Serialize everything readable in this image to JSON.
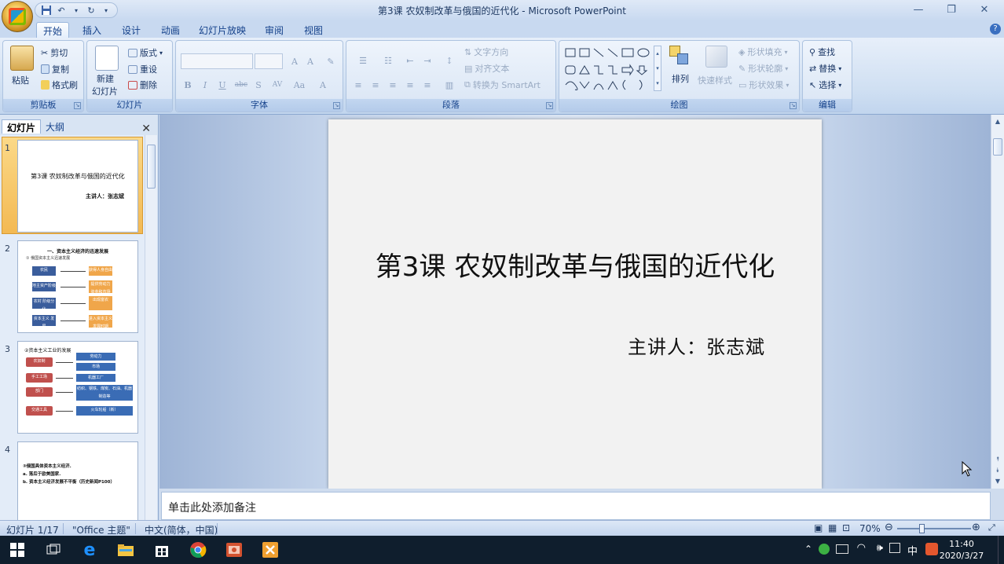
{
  "window": {
    "title": "第3课 农奴制改革与俄国的近代化 - Microsoft PowerPoint"
  },
  "quick_access": {
    "save_icon": "save-icon",
    "undo_icon": "undo-icon",
    "redo_icon": "redo-icon"
  },
  "ribbon_tabs": [
    "开始",
    "插入",
    "设计",
    "动画",
    "幻灯片放映",
    "审阅",
    "视图"
  ],
  "ribbon": {
    "clipboard": {
      "paste": "粘贴",
      "cut": "剪切",
      "copy": "复制",
      "format_painter": "格式刷",
      "label": "剪贴板"
    },
    "slides": {
      "new_slide": "新建",
      "new_slide_2": "幻灯片",
      "layout": "版式",
      "reset": "重设",
      "delete": "删除",
      "label": "幻灯片"
    },
    "font": {
      "label": "字体",
      "bold": "B",
      "italic": "I",
      "underline": "U",
      "strike": "abc",
      "shadow": "S",
      "spacing": "AV",
      "case": "Aa",
      "color": "A"
    },
    "paragraph": {
      "text_direction": "文字方向",
      "align_text": "对齐文本",
      "smartart": "转换为 SmartArt",
      "label": "段落"
    },
    "drawing": {
      "arrange": "排列",
      "quick_styles": "快速样式",
      "shape_fill": "形状填充",
      "shape_outline": "形状轮廓",
      "shape_effects": "形状效果",
      "label": "绘图"
    },
    "editing": {
      "find": "查找",
      "replace": "替换",
      "select": "选择",
      "label": "编辑"
    }
  },
  "left_pane": {
    "tabs": [
      "幻灯片",
      "大纲"
    ],
    "close": "✕",
    "thumbnails": [
      {
        "num": "1",
        "title": "第3课 农奴制改革与俄国的近代化",
        "subtitle": "主讲人：张志斌"
      },
      {
        "num": "2",
        "title": "一、资本主义经济的迅速发展",
        "caption": "① 俄国资本主义迅速发展",
        "rows": [
          [
            "农民",
            "获得人身自由"
          ],
          [
            "地主资产阶级",
            "提供劳动力 资金和市场"
          ],
          [
            "农村 阶级分化",
            "出现富农"
          ],
          [
            "资本主义 发展",
            "进入资本主义 发展时期"
          ]
        ]
      },
      {
        "num": "3",
        "title": "②资本主义工业的发展",
        "left": [
          "农奴制",
          "手工工场",
          "部门",
          "交通工具"
        ],
        "right": [
          "劳动力",
          "市场",
          "机器工厂",
          "纺织、钢铁、煤炭、石油、机器制造等",
          "火车轮船（新）"
        ]
      },
      {
        "num": "4",
        "lines": [
          "③俄国具体资本主义经济.",
          "a. 落后于欧美国家.",
          "b. 资本主义经济发展不平衡（历史新闻P100）"
        ]
      }
    ]
  },
  "slide": {
    "title": "第3课 农奴制改革与俄国的近代化",
    "subtitle": "主讲人：张志斌"
  },
  "notes": {
    "placeholder": "单击此处添加备注"
  },
  "status": {
    "slide_count": "幻灯片 1/17",
    "theme": "\"Office 主题\"",
    "language": "中文(简体，中国)",
    "zoom": "70%"
  },
  "taskbar": {
    "time": "11:40",
    "date": "2020/3/27",
    "ime": "中"
  }
}
